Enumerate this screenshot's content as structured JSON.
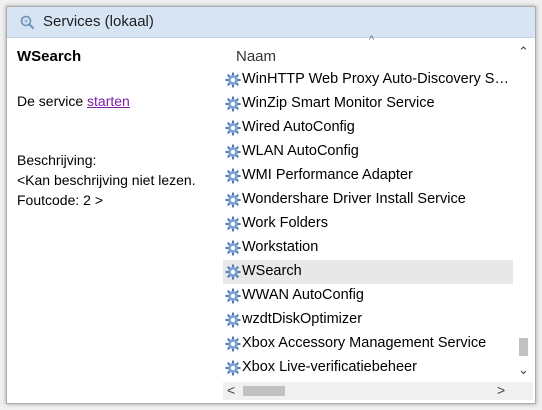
{
  "header": {
    "title": "Services (lokaal)",
    "icon": "magnifier-gear-icon"
  },
  "details": {
    "service_name": "WSearch",
    "action_prefix": "De service ",
    "action_link": "starten",
    "description_label": "Beschrijving:",
    "description_text": "<Kan beschrijving niet lezen.",
    "error_code": "Foutcode: 2 >"
  },
  "table": {
    "column": "Naam",
    "sort_indicator": "^",
    "selected_index": 8,
    "rows": [
      "WinHTTP Web Proxy Auto-Discovery Service",
      "WinZip Smart Monitor Service",
      "Wired AutoConfig",
      "WLAN AutoConfig",
      "WMI Performance Adapter",
      "Wondershare Driver Install Service",
      "Work Folders",
      "Workstation",
      "WSearch",
      "WWAN AutoConfig",
      "wzdtDiskOptimizer",
      "Xbox Accessory Management Service",
      "Xbox Live-verificatiebeheer"
    ]
  },
  "scrollbars": {
    "up": "⌃",
    "down": "⌄",
    "left": "<",
    "right": ">"
  },
  "colors": {
    "header_bg": "#d6e4f4",
    "link": "#7a1fa2",
    "selected_row": "#e8e8e8",
    "gear": "#4a79b8"
  }
}
